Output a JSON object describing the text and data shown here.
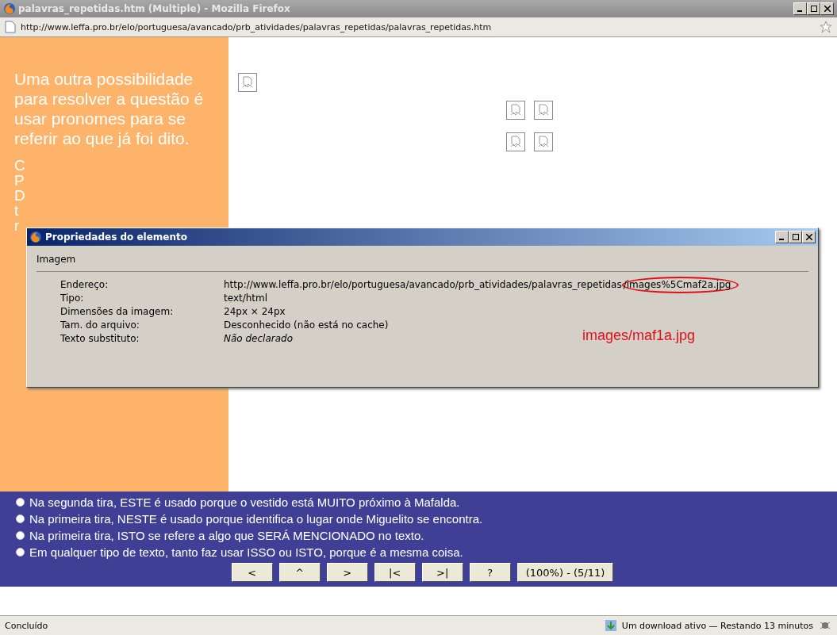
{
  "window": {
    "title": "palavras_repetidas.htm (Multiple) - Mozilla Firefox"
  },
  "address_bar": {
    "url": "http://www.leffa.pro.br/elo/portuguesa/avancado/prb_atividades/palavras_repetidas/palavras_repetidas.htm"
  },
  "page": {
    "side_text": "Uma outra possibilidade para resolver a questão é usar pronomes para se referir ao que já foi dito.",
    "side_text_cut": [
      "C",
      "P",
      "D",
      "t",
      "r"
    ],
    "broken_images": [
      {
        "kind": "single"
      },
      {
        "kind": "grid"
      },
      {
        "kind": "grid"
      },
      {
        "kind": "grid"
      },
      {
        "kind": "grid"
      }
    ],
    "options": [
      {
        "text": "Na segunda tira, ESTE é usado porque o vestido está MUITO próximo à Mafalda.",
        "selected": false
      },
      {
        "text": "Na primeira tira, NESTE é usado porque identifica o lugar onde Miguelito se encontra.",
        "selected": false
      },
      {
        "text": "Na primeira tira, ISTO se refere a algo que SERÁ MENCIONADO no texto.",
        "selected": false
      },
      {
        "text": "Em qualquer tipo de texto, tanto faz usar ISSO ou ISTO, porque é a mesma coisa.",
        "selected": false
      }
    ],
    "nav_buttons": [
      "<",
      "^",
      ">",
      "|<",
      ">|",
      "?",
      "(100%) - (5/11)"
    ]
  },
  "dialog": {
    "title": "Propriedades do elemento",
    "section": "Imagem",
    "fields": [
      {
        "label": "Endereço:",
        "value": "http://www.leffa.pro.br/elo/portuguesa/avancado/prb_atividades/palavras_repetidas/images%5Cmaf2a.jpg",
        "kind": "circled"
      },
      {
        "label": "Tipo:",
        "value": "text/html",
        "kind": "plain"
      },
      {
        "label": "Dimensões da imagem:",
        "value": "24px × 24px",
        "kind": "plain"
      },
      {
        "label": "Tam. do arquivo:",
        "value": "Desconhecido (não está no cache)",
        "kind": "plain"
      },
      {
        "label": "Texto substituto:",
        "value": "Não declarado",
        "kind": "italic"
      }
    ],
    "annotation": "images/maf1a.jpg"
  },
  "status_bar": {
    "status": "Concluído",
    "download": "Um download ativo — Restando 13 minutos"
  }
}
